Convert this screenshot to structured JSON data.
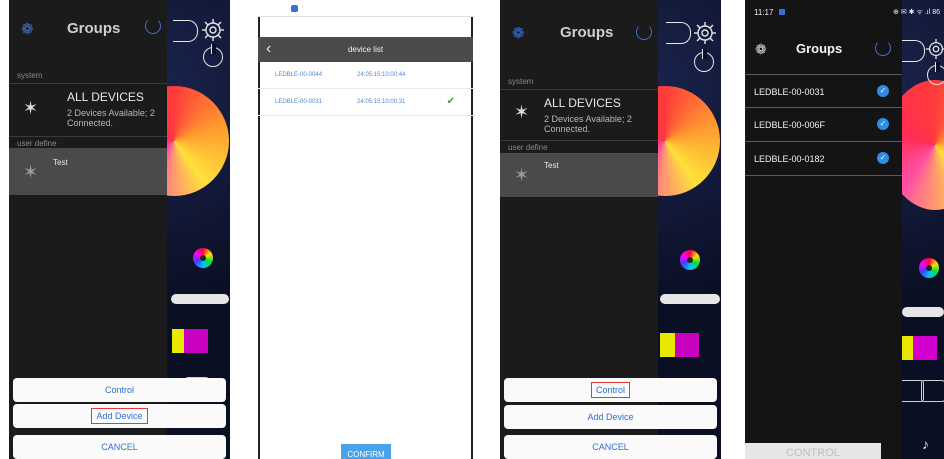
{
  "panel1": {
    "header_title": "Groups",
    "section_system": "system",
    "all_devices_title": "ALL DEVICES",
    "all_devices_sub": "2 Devices Available; 2 Connected.",
    "section_user": "user define",
    "group_name": "Test",
    "sheet": {
      "control": "Control",
      "add_device": "Add Device",
      "cancel": "CANCEL"
    }
  },
  "panel2": {
    "title": "device list",
    "rows": [
      {
        "name": "LEDBLE-00-0044",
        "time": "24:05:15:10:00:44",
        "checked": false
      },
      {
        "name": "LEDBLE-00-0031",
        "time": "24:05:15:10:00:31",
        "checked": true
      }
    ],
    "confirm": "CONFIRM"
  },
  "panel3": {
    "header_title": "Groups",
    "section_system": "system",
    "all_devices_title": "ALL DEVICES",
    "all_devices_sub": "2 Devices Available; 2 Connected.",
    "section_user": "user define",
    "group_name": "Test",
    "sheet": {
      "control": "Control",
      "add_device": "Add Device",
      "cancel": "CANCEL"
    }
  },
  "panel4": {
    "status_time": "11:17",
    "status_right": "⊕ ✉ ✱ ᯤ .ıl 86",
    "header_title": "Groups",
    "devices": [
      "LEDBLE-00-0031",
      "LEDBLE-00-006F",
      "LEDBLE-00-0182"
    ],
    "control": "CONTROL"
  },
  "colors": {
    "accent_blue": "#2f6fd6",
    "highlight_red": "#e23a3a",
    "check_green": "#3aa13a",
    "check_blue": "#2f8de4"
  }
}
